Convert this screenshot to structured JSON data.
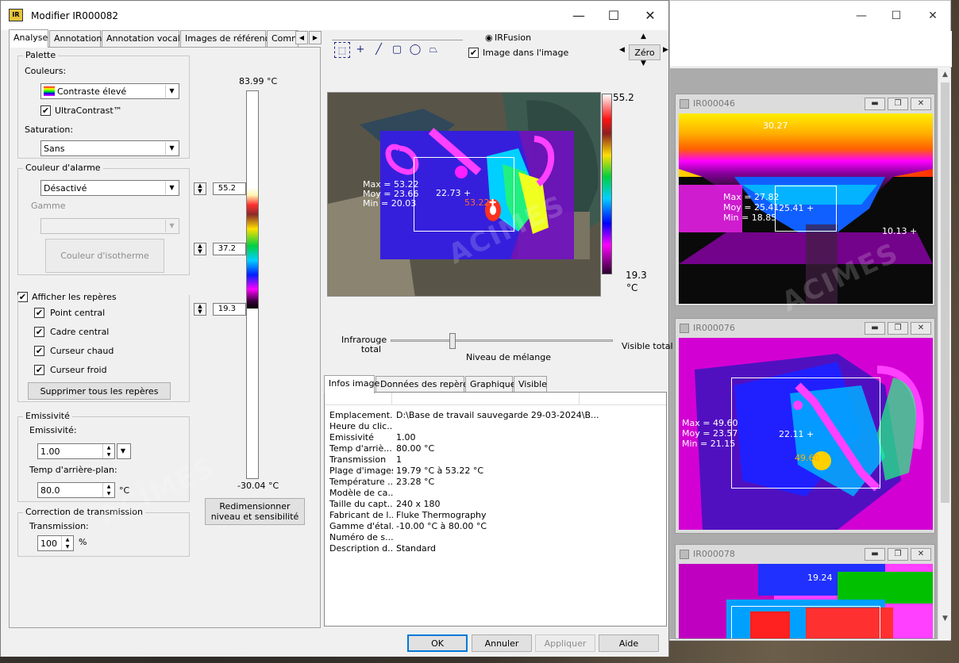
{
  "dialog": {
    "title": "Modifier IR000082",
    "minimize": "—",
    "maximize": "☐",
    "close": "✕"
  },
  "tabs": [
    "Analyse",
    "Annotations",
    "Annotation vocale",
    "Images de référence",
    "Comm"
  ],
  "palette": {
    "group": "Palette",
    "colors_label": "Couleurs:",
    "colors_value": "Contraste élevé",
    "ultracontrast": "UltraContrast™",
    "saturation_label": "Saturation:",
    "saturation_value": "Sans"
  },
  "alarm": {
    "group": "Couleur d'alarme",
    "value": "Désactivé",
    "range_label": "Gamme",
    "isotherm_button": "Couleur d'isotherme"
  },
  "markers": {
    "show_label": "Afficher les repères",
    "items": [
      "Point central",
      "Cadre central",
      "Curseur chaud",
      "Curseur froid"
    ],
    "delete_button": "Supprimer tous les repères"
  },
  "emissivity": {
    "group": "Emissivité",
    "label": "Emissivité:",
    "value": "1.00",
    "bg_label": "Temp d'arrière-plan:",
    "bg_value": "80.0",
    "bg_unit": "°C"
  },
  "transmission": {
    "group": "Correction de transmission",
    "label": "Transmission:",
    "value": "100",
    "unit": "%"
  },
  "scale": {
    "top": "83.99 °C",
    "bottom": "-30.04 °C",
    "marker_high": "55.2",
    "marker_mid": "37.2",
    "marker_low": "19.3",
    "resize_button_line1": "Redimensionner",
    "resize_button_line2": "niveau et sensibilité"
  },
  "viewer": {
    "irfusion": "IRFusion",
    "pip": "Image dans l'image",
    "zero": "Zéro",
    "scale_max": "55.2",
    "scale_min": "19.3",
    "scale_unit": "°C",
    "box_max": "Max = 53.22",
    "box_avg": "Moy = 23.66",
    "box_min": "Min = 20.03",
    "center_value": "22.73 +",
    "hot_value": "53.22",
    "blend_left_1": "Infrarouge",
    "blend_left_2": "total",
    "blend_center": "Niveau de mélange",
    "blend_right": "Visible total",
    "blend_level_pct": 28
  },
  "info_tabs": [
    "Infos image",
    "Données des repères",
    "Graphique",
    "Visible"
  ],
  "info_rows": [
    {
      "k": "Emplacement...",
      "v": "D:\\Base de travail sauvegarde 29-03-2024\\B..."
    },
    {
      "k": "Heure du clic...",
      "v": ""
    },
    {
      "k": "Emissivité",
      "v": "1.00"
    },
    {
      "k": "Temp d'arriè...",
      "v": "80.00 °C"
    },
    {
      "k": "Transmission",
      "v": "1"
    },
    {
      "k": "Plage d'images",
      "v": "19.79 °C à 53.22 °C"
    },
    {
      "k": "Température ...",
      "v": "23.28 °C"
    },
    {
      "k": "Modèle de ca...",
      "v": ""
    },
    {
      "k": "Taille du capt...",
      "v": "240 x 180"
    },
    {
      "k": "Fabricant de l...",
      "v": "Fluke Thermography"
    },
    {
      "k": "Gamme d'étal...",
      "v": "-10.00 °C à 80.00 °C"
    },
    {
      "k": "Numéro de s...",
      "v": ""
    },
    {
      "k": "Description d...",
      "v": "Standard"
    }
  ],
  "buttons": {
    "ok": "OK",
    "cancel": "Annuler",
    "apply": "Appliquer",
    "help": "Aide"
  },
  "children": [
    {
      "title": "IR000046",
      "top_value": "30.27",
      "max": "Max = 27.82",
      "avg": "Moy = 25.41",
      "min": "Min = 18.85",
      "center": "25.41 +",
      "side": "10.13 +"
    },
    {
      "title": "IR000076",
      "max": "Max = 49.60",
      "avg": "Moy = 23.57",
      "min": "Min = 21.15",
      "center": "22.11 +",
      "hot": "49.60"
    },
    {
      "title": "IR000078",
      "top_value": "19.24"
    }
  ],
  "watermark": "ACIMES",
  "colors": {
    "accent": "#0078d7",
    "hot_label": "#ff6a2a",
    "window_bg": "#f0f0f0"
  }
}
